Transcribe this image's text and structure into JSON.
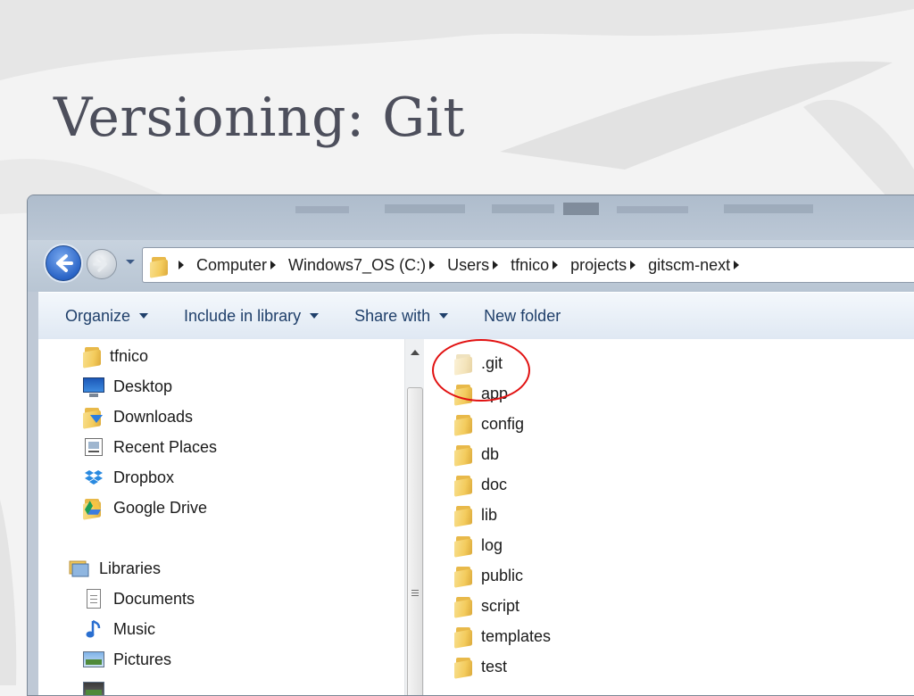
{
  "slide": {
    "title": "Versioning: Git"
  },
  "address": {
    "crumbs": [
      "Computer",
      "Windows7_OS (C:)",
      "Users",
      "tfnico",
      "projects",
      "gitscm-next"
    ]
  },
  "toolbar": {
    "organize": "Organize",
    "include_in_library": "Include in library",
    "share_with": "Share with",
    "new_folder": "New folder"
  },
  "nav_pane": {
    "items": [
      {
        "label": "tfnico",
        "icon": "folder-icon"
      },
      {
        "label": "Desktop",
        "icon": "desktop-icon"
      },
      {
        "label": "Downloads",
        "icon": "downloads-icon"
      },
      {
        "label": "Recent Places",
        "icon": "recent-places-icon"
      },
      {
        "label": "Dropbox",
        "icon": "dropbox-icon"
      },
      {
        "label": "Google Drive",
        "icon": "google-drive-icon"
      }
    ],
    "libraries": {
      "label": "Libraries",
      "icon": "libraries-icon"
    },
    "library_items": [
      {
        "label": "Documents",
        "icon": "documents-icon"
      },
      {
        "label": "Music",
        "icon": "music-icon"
      },
      {
        "label": "Pictures",
        "icon": "pictures-icon"
      }
    ]
  },
  "files": [
    {
      "name": ".git",
      "hidden": true,
      "highlighted": true
    },
    {
      "name": "app"
    },
    {
      "name": "config"
    },
    {
      "name": "db"
    },
    {
      "name": "doc"
    },
    {
      "name": "lib"
    },
    {
      "name": "log"
    },
    {
      "name": "public"
    },
    {
      "name": "script"
    },
    {
      "name": "templates"
    },
    {
      "name": "test"
    }
  ],
  "colors": {
    "highlight_circle": "#e11111",
    "title_text": "#4d4f5c",
    "command_text": "#1f3f6a"
  }
}
